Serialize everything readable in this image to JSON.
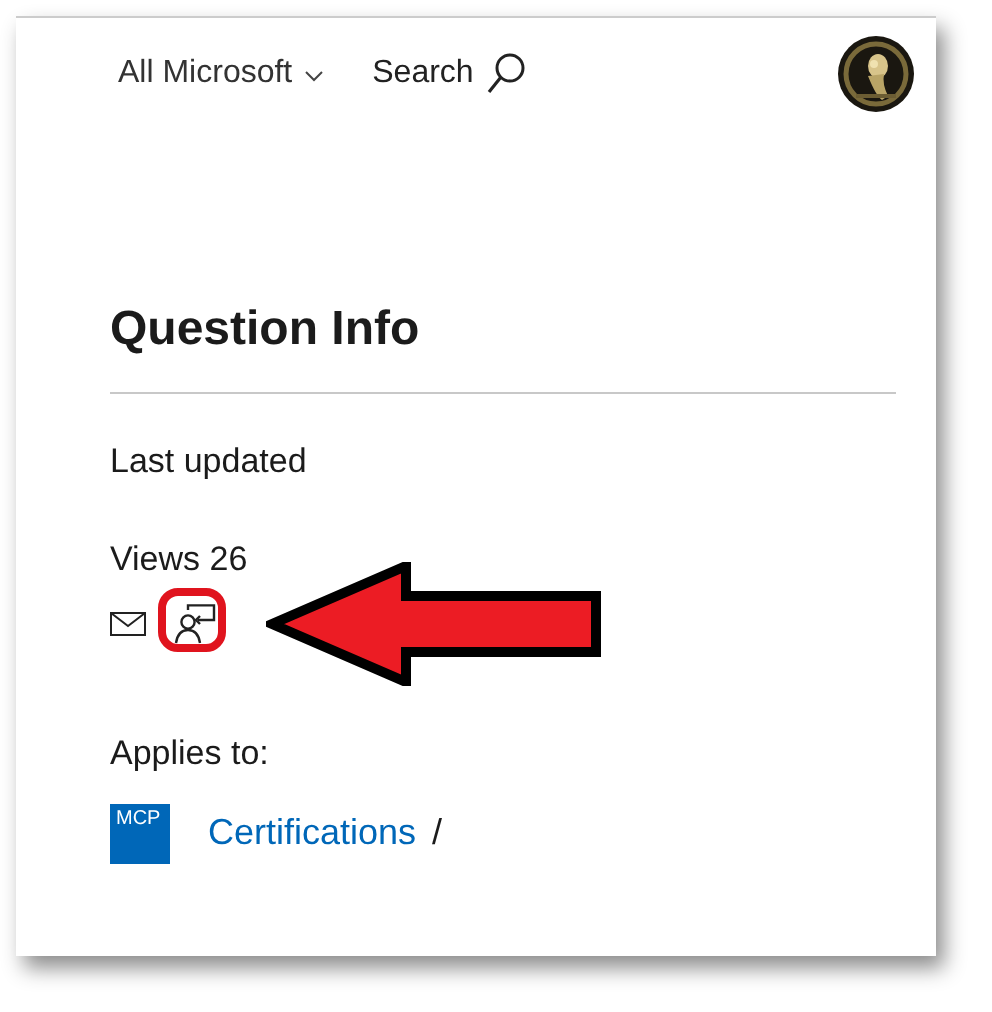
{
  "header": {
    "scope_menu": "All Microsoft",
    "search": "Search"
  },
  "title": "Question Info",
  "last_updated": "Last updated",
  "views": "Views 26",
  "actions": [
    {
      "kind": "email",
      "highlighted": false
    },
    {
      "kind": "report",
      "highlighted": true
    }
  ],
  "applies_to": {
    "label": "Applies to:",
    "items": [
      {
        "badge": "MCP",
        "link": "Certifications",
        "separator": "/"
      }
    ]
  }
}
